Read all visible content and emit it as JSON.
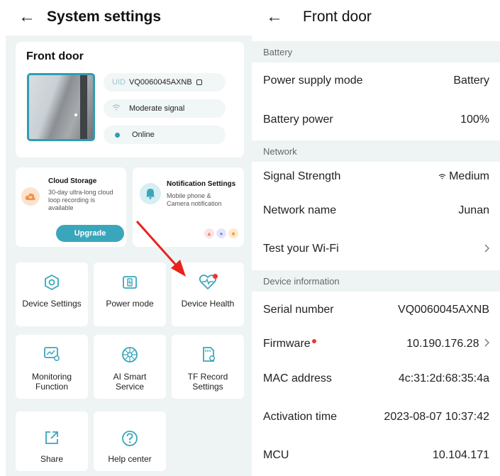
{
  "left": {
    "title": "System settings",
    "device": {
      "name": "Front door",
      "uid_label": "UID",
      "uid": "VQ0060045AXNB",
      "signal": "Moderate signal",
      "status": "Online"
    },
    "cloud": {
      "title": "Cloud Storage",
      "desc": [
        "30-day ultra-long cloud",
        "loop recording is",
        "available"
      ],
      "button": "Upgrade"
    },
    "notification": {
      "title": "Notification Settings",
      "desc": [
        "Mobile phone &",
        "Camera notification"
      ]
    },
    "tiles": [
      {
        "label": [
          "Device Settings"
        ],
        "icon": "hexagon-gear-icon"
      },
      {
        "label": [
          "Power mode"
        ],
        "icon": "battery-icon"
      },
      {
        "label": [
          "Device Health"
        ],
        "icon": "heart-pulse-icon"
      },
      {
        "label": [
          "Monitoring",
          "Function"
        ],
        "icon": "monitor-chart-icon"
      },
      {
        "label": [
          "AI Smart",
          "Service"
        ],
        "icon": "ai-chip-icon"
      },
      {
        "label": [
          "TF Record",
          "Settings"
        ],
        "icon": "sd-card-icon"
      },
      {
        "label": [
          "Share"
        ],
        "icon": "share-icon"
      },
      {
        "label": [
          "Help center"
        ],
        "icon": "question-icon"
      }
    ]
  },
  "right": {
    "title": "Front door",
    "sections": {
      "battery": "Battery",
      "network": "Network",
      "device_info": "Device information"
    },
    "rows": {
      "power_supply": {
        "label": "Power supply mode",
        "value": "Battery"
      },
      "battery_power": {
        "label": "Battery power",
        "value": "100%"
      },
      "signal_strength": {
        "label": "Signal Strength",
        "value": "Medium"
      },
      "network_name": {
        "label": "Network name",
        "value": "Junan"
      },
      "test_wifi": {
        "label": "Test your Wi-Fi"
      },
      "serial": {
        "label": "Serial number",
        "value": "VQ0060045AXNB"
      },
      "firmware": {
        "label": "Firmware",
        "value": "10.190.176.28"
      },
      "mac": {
        "label": "MAC address",
        "value": "4c:31:2d:68:35:4a"
      },
      "activation": {
        "label": "Activation time",
        "value": "2023-08-07 10:37:42"
      },
      "mcu": {
        "label": "MCU",
        "value": "10.104.171"
      }
    }
  },
  "colors": {
    "accent": "#3aa6bb",
    "panel_bg": "#eef4f4",
    "badge": "#e53935",
    "arrow": "#e8231c"
  }
}
